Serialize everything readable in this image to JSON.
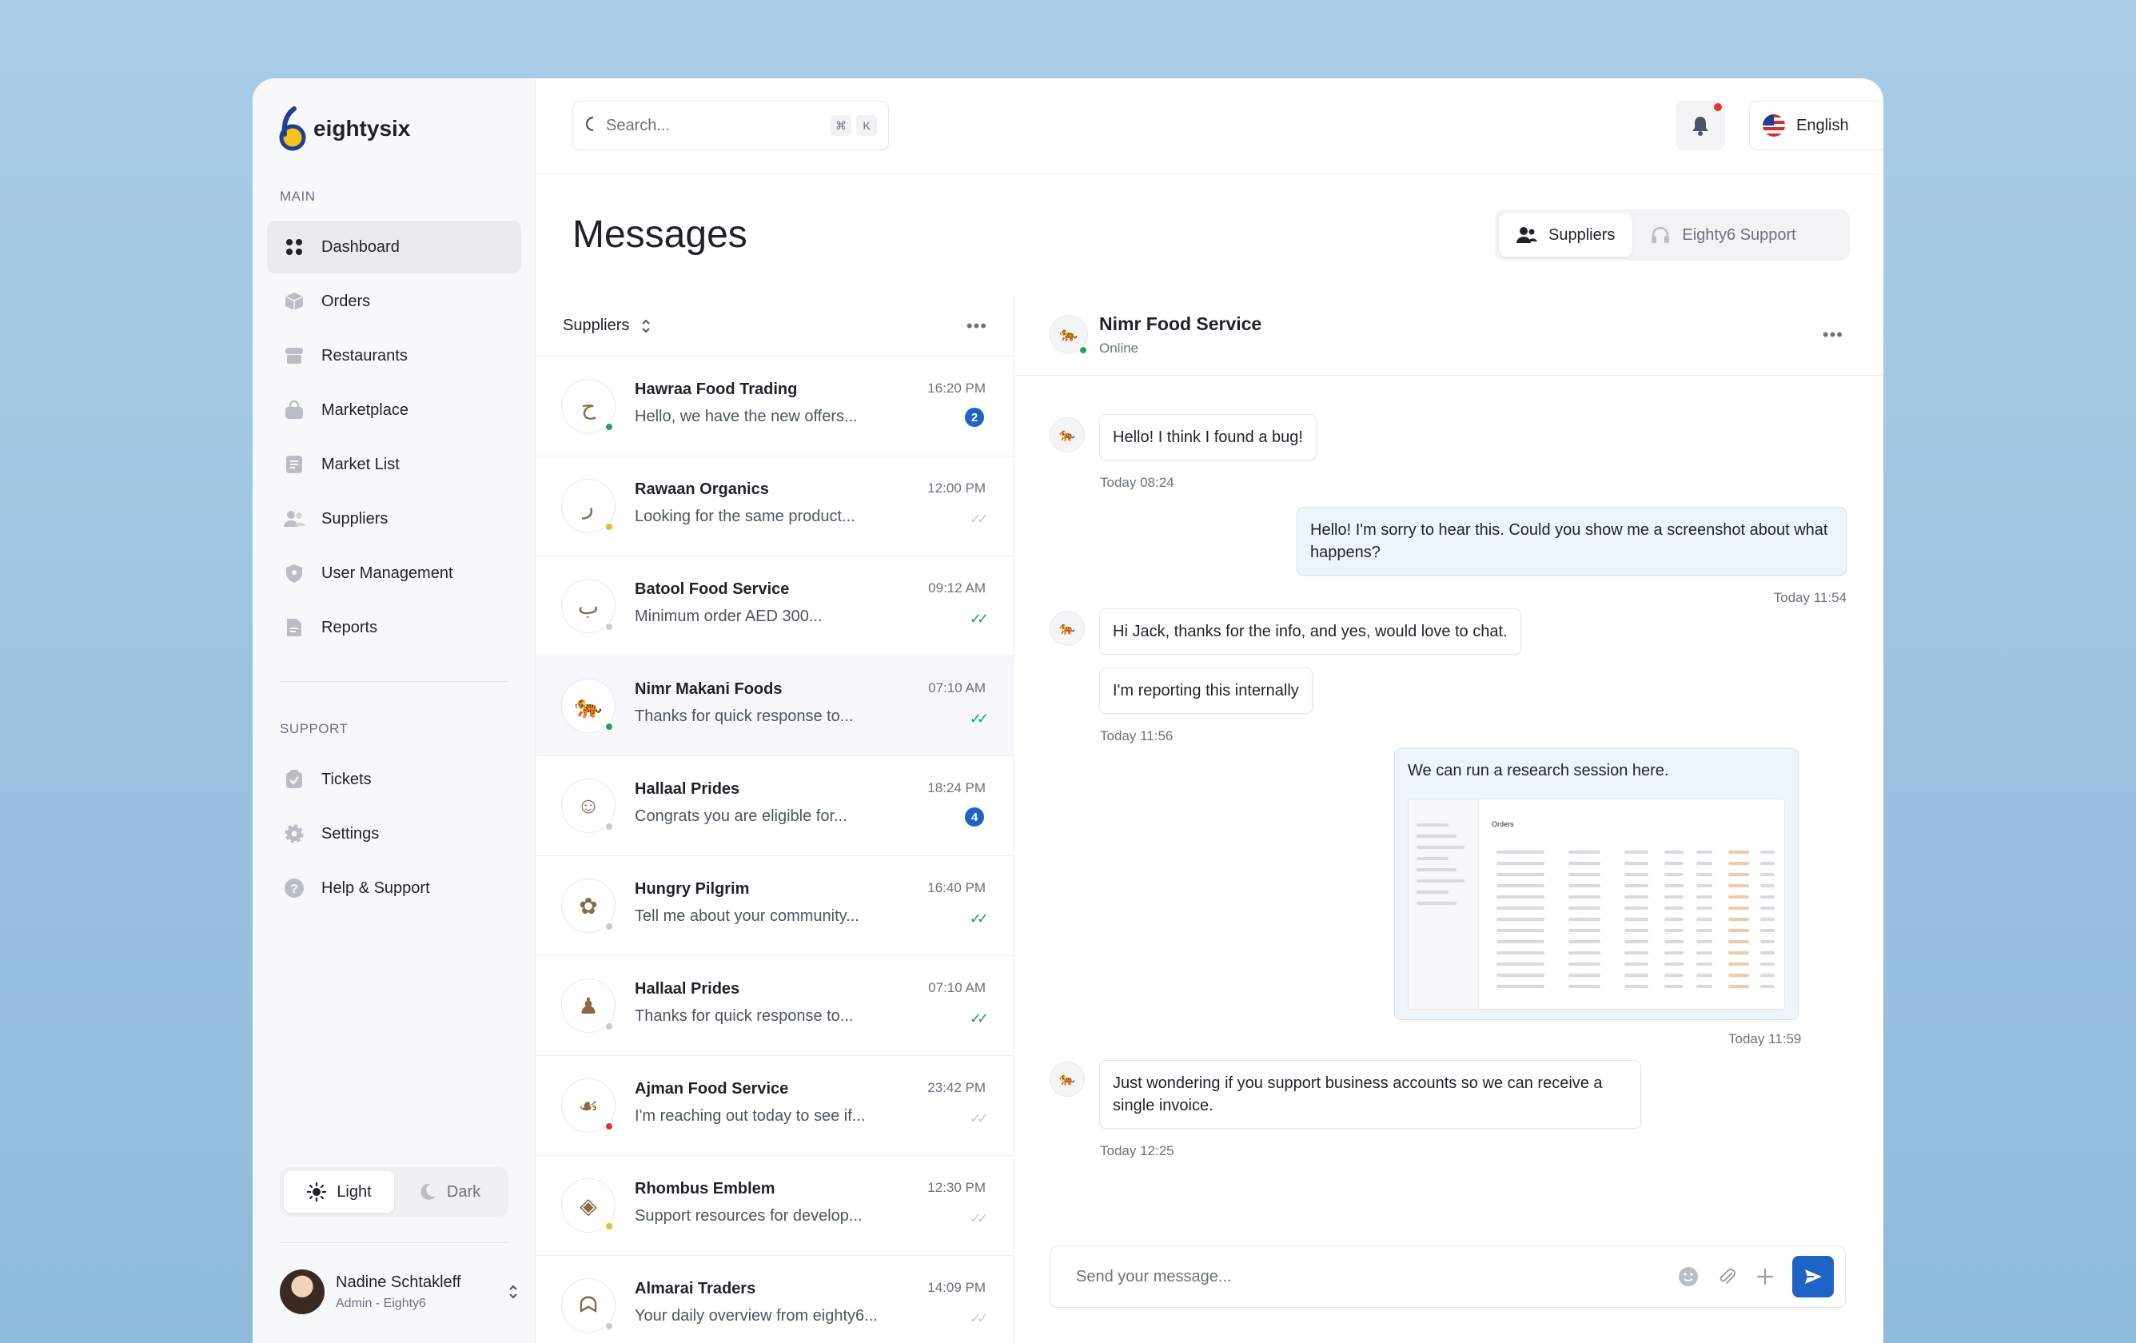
{
  "app": {
    "name": "eightysix"
  },
  "sidebar": {
    "main_label": "MAIN",
    "support_label": "SUPPORT",
    "main_items": [
      {
        "label": "Dashboard",
        "icon": "grid-icon",
        "active": true
      },
      {
        "label": "Orders",
        "icon": "box-icon"
      },
      {
        "label": "Restaurants",
        "icon": "store-icon"
      },
      {
        "label": "Marketplace",
        "icon": "bag-icon"
      },
      {
        "label": "Market List",
        "icon": "list-icon"
      },
      {
        "label": "Suppliers",
        "icon": "users-icon"
      },
      {
        "label": "User Management",
        "icon": "shield-icon"
      },
      {
        "label": "Reports",
        "icon": "report-icon"
      }
    ],
    "support_items": [
      {
        "label": "Tickets",
        "icon": "clipboard-check-icon"
      },
      {
        "label": "Settings",
        "icon": "gear-icon"
      },
      {
        "label": "Help & Support",
        "icon": "question-icon"
      }
    ],
    "theme": {
      "light": "Light",
      "dark": "Dark",
      "selected": "Light"
    },
    "user": {
      "name": "Nadine Schtakleff",
      "role": "Admin - Eighty6"
    }
  },
  "topbar": {
    "search_placeholder": "Search...",
    "shortcut": [
      "⌘",
      "K"
    ],
    "language": "English"
  },
  "page": {
    "title": "Messages",
    "tabs": [
      {
        "label": "Suppliers",
        "selected": true
      },
      {
        "label": "Eighty6 Support"
      }
    ]
  },
  "list": {
    "header": "Suppliers",
    "conversations": [
      {
        "name": "Hawraa Food Trading",
        "preview": "Hello, we have the new offers...",
        "time": "16:20 PM",
        "badge": "2",
        "status": "#22a45d"
      },
      {
        "name": "Rawaan Organics",
        "preview": "Looking for the same product...",
        "time": "12:00 PM",
        "read": "delivered",
        "status": "#e8b93a"
      },
      {
        "name": "Batool Food Service",
        "preview": "Minimum order AED 300...",
        "time": "09:12 AM",
        "read": "read",
        "status": "#c9cdd3"
      },
      {
        "name": "Nimr Makani Foods",
        "preview": "Thanks for quick response to...",
        "time": "07:10 AM",
        "read": "read",
        "status": "#22a45d",
        "active": true
      },
      {
        "name": "Hallaal Prides",
        "preview": "Congrats you are eligible for...",
        "time": "18:24 PM",
        "badge": "4",
        "status": "#c9cdd3"
      },
      {
        "name": "Hungry Pilgrim",
        "preview": "Tell me about your community...",
        "time": "16:40 PM",
        "read": "read",
        "status": "#c9cdd3"
      },
      {
        "name": "Hallaal Prides",
        "preview": "Thanks for quick response to...",
        "time": "07:10 AM",
        "read": "read",
        "status": "#c9cdd3"
      },
      {
        "name": "Ajman Food Service",
        "preview": "I'm reaching out today to see if...",
        "time": "23:42 PM",
        "read": "delivered",
        "status": "#e5342a"
      },
      {
        "name": "Rhombus Emblem",
        "preview": "Support resources for develop...",
        "time": "12:30 PM",
        "read": "delivered",
        "status": "#e8b93a"
      },
      {
        "name": "Almarai Traders",
        "preview": "Your daily overview from eighty6...",
        "time": "14:09 PM",
        "read": "delivered",
        "status": "#c9cdd3"
      }
    ]
  },
  "chat": {
    "name": "Nimr Food Service",
    "status": "Online",
    "messages": [
      {
        "text": "Hello! I think I found a bug!",
        "time": "Today 08:24"
      },
      {
        "text": "Hello! I'm sorry to hear this. Could you show me a screenshot about what happens?",
        "time": "Today 11:54"
      },
      {
        "text": "Hi Jack, thanks for the info, and yes, would love to chat."
      },
      {
        "text": "I'm reporting this internally",
        "time": "Today 11:56"
      },
      {
        "text": "We can run a research session here.",
        "time": "Today 11:59",
        "attachment_title": "Orders"
      },
      {
        "text": "Just wondering if you support business accounts so we can receive a single invoice.",
        "time": "Today 12:25"
      }
    ],
    "composer_placeholder": "Send your message..."
  },
  "colors": {
    "accent": "#1f63c6",
    "read_check": "#22a45d",
    "unread_check": "#c9cdd3",
    "notification": "#e5342a"
  }
}
